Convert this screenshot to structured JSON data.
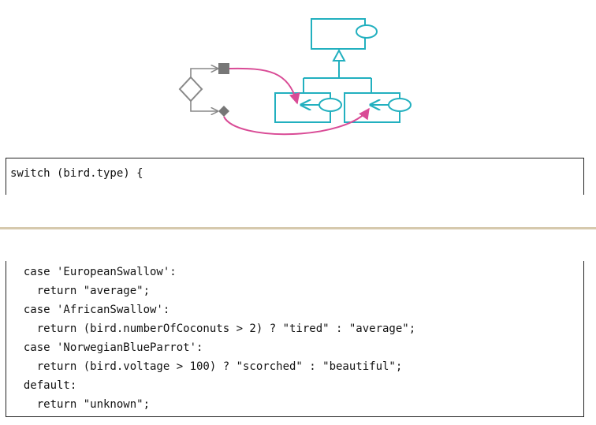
{
  "colors": {
    "class_box": "#22b0bf",
    "arrow": "#d94b96",
    "flowchart": "#888888",
    "divider": "#d6c9ad"
  },
  "code": {
    "first_line": "switch (bird.type) {",
    "lines": [
      "  case 'EuropeanSwallow':",
      "    return \"average\";",
      "  case 'AfricanSwallow':",
      "    return (bird.numberOfCoconuts > 2) ? \"tired\" : \"average\";",
      "  case 'NorwegianBlueParrot':",
      "    return (bird.voltage > 100) ? \"scorched\" : \"beautiful\";",
      "  default:",
      "    return \"unknown\";"
    ]
  }
}
